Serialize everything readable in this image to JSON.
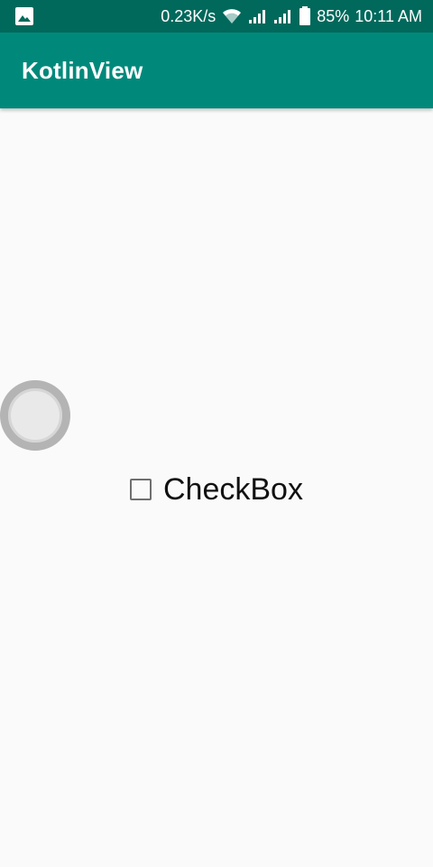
{
  "status_bar": {
    "network_speed": "0.23K/s",
    "battery": "85%",
    "time": "10:11 AM",
    "icons": [
      "image-icon",
      "wifi-icon",
      "signal-icon",
      "signal-icon",
      "battery-icon"
    ]
  },
  "app_bar": {
    "title": "KotlinView"
  },
  "checkbox": {
    "label": "CheckBox",
    "checked": false
  },
  "colors": {
    "status_bar": "#00695c",
    "app_bar": "#00897b",
    "background": "#fafafa"
  }
}
